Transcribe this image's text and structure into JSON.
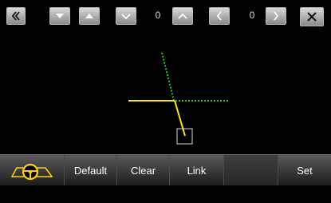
{
  "toolbar": {
    "counter_left": "0",
    "counter_right": "0"
  },
  "bottom_bar": {
    "default_label": "Default",
    "clear_label": "Clear",
    "link_label": "Link",
    "set_label": "Set"
  },
  "colors": {
    "guide_line": "#ffe800",
    "dotted_line": "#2cc02c",
    "button_gradient_top": "#d8d8d8",
    "button_gradient_bottom": "#8a8a8a",
    "steering_icon": "#ffd000"
  },
  "icons": [
    "back-double-chevron-icon",
    "arrow-down-icon",
    "arrow-up-icon",
    "chevron-down-icon",
    "chevron-up-icon",
    "chevron-left-icon",
    "chevron-right-icon",
    "close-icon",
    "steering-wheel-car-icon"
  ]
}
